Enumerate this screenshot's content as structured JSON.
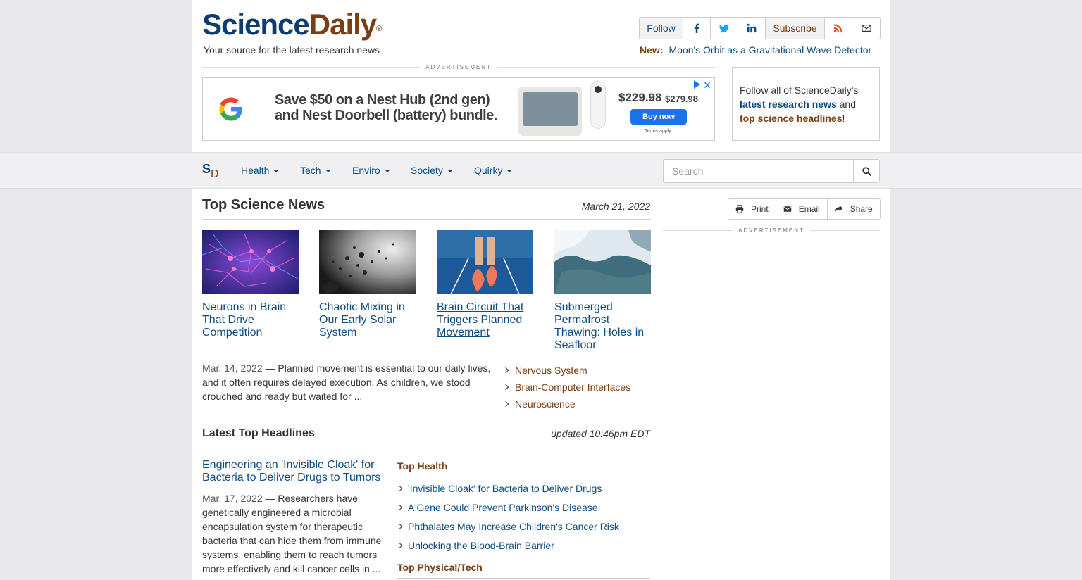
{
  "header": {
    "logo_science": "Science",
    "logo_daily": "Daily",
    "logo_reg": "®",
    "tagline": "Your source for the latest research news",
    "follow_label": "Follow",
    "subscribe_label": "Subscribe",
    "new_label": "New:",
    "new_text": "Moon's Orbit as a Gravitational Wave Detector",
    "icons": [
      "facebook-icon",
      "twitter-icon",
      "linkedin-icon",
      "rss-icon",
      "email-icon"
    ]
  },
  "advertisement_label": "ADVERTISEMENT",
  "ad": {
    "line1": "Save $50 on a Nest Hub (2nd gen)",
    "line2": "and Nest Doorbell (battery) bundle.",
    "price": "$229.98",
    "old_price": "$279.98",
    "button": "Buy now",
    "terms": "Terms apply."
  },
  "follow_box": {
    "text1": "Follow all of ScienceDaily's",
    "link1": "latest research news",
    "text2": " and",
    "link2": "top science headlines",
    "text3": "!"
  },
  "nav": {
    "logo_s": "S",
    "logo_d": "D",
    "items": [
      "Health",
      "Tech",
      "Enviro",
      "Society",
      "Quirky"
    ],
    "search_placeholder": "Search"
  },
  "top_news": {
    "heading": "Top Science News",
    "date": "March 21, 2022",
    "stories": [
      {
        "title": "Neurons in Brain That Drive Competition"
      },
      {
        "title": "Chaotic Mixing in Our Early Solar System"
      },
      {
        "title": "Brain Circuit That Triggers Planned Movement"
      },
      {
        "title": "Submerged Permafrost Thawing: Holes in Seafloor"
      }
    ],
    "summary_date": "Mar. 14, 2022",
    "summary_text": "Planned movement is essential to our daily lives, and it often requires delayed execution. As children, we stood crouched and ready but waited for ...",
    "topics": [
      "Nervous System",
      "Brain-Computer Interfaces",
      "Neuroscience"
    ]
  },
  "actions": {
    "print": "Print",
    "email": "Email",
    "share": "Share"
  },
  "latest": {
    "heading": "Latest Top Headlines",
    "updated": "updated 10:46pm EDT",
    "lead_title": "Engineering an 'Invisible Cloak' for Bacteria to Deliver Drugs to Tumors",
    "lead_date": "Mar. 17, 2022",
    "lead_text": "Researchers have genetically engineered a microbial encapsulation system for therapeutic bacteria that can hide them from immune systems, enabling them to reach tumors more effectively and kill cancer cells in ...",
    "top_health_label": "Top Health",
    "top_health": [
      "'Invisible Cloak' for Bacteria to Deliver Drugs",
      "A Gene Could Prevent Parkinson's Disease",
      "Phthalates May Increase Children's Cancer Risk",
      "Unlocking the Blood-Brain Barrier"
    ],
    "top_physical_label": "Top Physical/Tech"
  },
  "colors": {
    "brand_blue": "#0d3d6e",
    "link_blue": "#0d4b80",
    "brand_brown": "#7a3e12"
  }
}
